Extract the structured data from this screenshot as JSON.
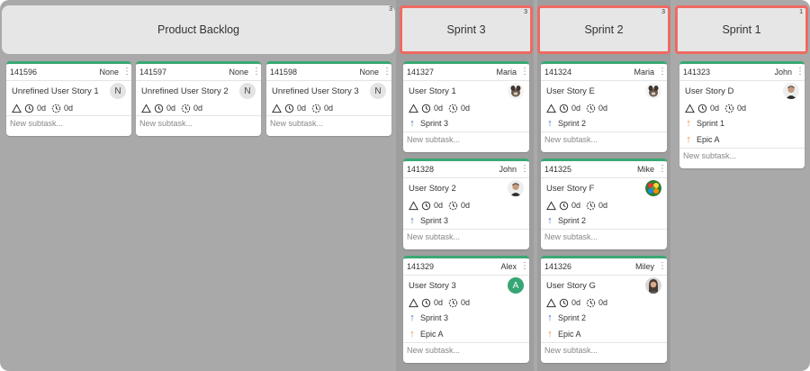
{
  "columns": [
    {
      "name": "Product Backlog",
      "count": "3"
    },
    {
      "name": "Sprint 3",
      "count": "3"
    },
    {
      "name": "Sprint 2",
      "count": "3"
    },
    {
      "name": "Sprint 1",
      "count": "1"
    }
  ],
  "cards": {
    "backlog": [
      {
        "id": "141596",
        "assignee": "None",
        "title": "Unrefined User Story 1",
        "avatar": "N",
        "estimate": "0d",
        "spent": "0d",
        "subtask_placeholder": "New subtask..."
      },
      {
        "id": "141597",
        "assignee": "None",
        "title": "Unrefined User Story 2",
        "avatar": "N",
        "estimate": "0d",
        "spent": "0d",
        "subtask_placeholder": "New subtask..."
      },
      {
        "id": "141598",
        "assignee": "None",
        "title": "Unrefined User Story 3",
        "avatar": "N",
        "estimate": "0d",
        "spent": "0d",
        "subtask_placeholder": "New subtask..."
      }
    ],
    "sprint3": [
      {
        "id": "141327",
        "assignee": "Maria",
        "title": "User Story 1",
        "estimate": "0d",
        "spent": "0d",
        "parent": "Sprint 3",
        "subtask_placeholder": "New subtask..."
      },
      {
        "id": "141328",
        "assignee": "John",
        "title": "User Story 2",
        "estimate": "0d",
        "spent": "0d",
        "parent": "Sprint 3",
        "subtask_placeholder": "New subtask..."
      },
      {
        "id": "141329",
        "assignee": "Alex",
        "title": "User Story 3",
        "avatar": "A",
        "estimate": "0d",
        "spent": "0d",
        "parent": "Sprint 3",
        "epic": "Epic A",
        "subtask_placeholder": "New subtask..."
      }
    ],
    "sprint2": [
      {
        "id": "141324",
        "assignee": "Maria",
        "title": "User Story E",
        "estimate": "0d",
        "spent": "0d",
        "parent": "Sprint 2",
        "subtask_placeholder": "New subtask..."
      },
      {
        "id": "141325",
        "assignee": "Mike",
        "title": "User Story F",
        "estimate": "0d",
        "spent": "0d",
        "parent": "Sprint 2",
        "subtask_placeholder": "New subtask..."
      },
      {
        "id": "141326",
        "assignee": "Miley",
        "title": "User Story G",
        "estimate": "0d",
        "spent": "0d",
        "parent": "Sprint 2",
        "epic": "Epic A",
        "subtask_placeholder": "New subtask..."
      }
    ],
    "sprint1": [
      {
        "id": "141323",
        "assignee": "John",
        "title": "User Story D",
        "estimate": "0d",
        "spent": "0d",
        "parent": "Sprint 1",
        "epic": "Epic A",
        "subtask_placeholder": "New subtask..."
      }
    ]
  },
  "icons": {
    "priority": "triangle-icon",
    "estimate": "clock-icon",
    "spent": "clock-dashed-icon",
    "sprint_link": "arrow-up-icon",
    "epic_link": "arrow-up-icon",
    "menu": "kebab-menu-icon"
  },
  "colors": {
    "accent_green": "#3aa873",
    "sprint_border": "#ef6a62",
    "sprint_arrow": "#3f72c8",
    "epic_arrow": "#f08a3c"
  }
}
